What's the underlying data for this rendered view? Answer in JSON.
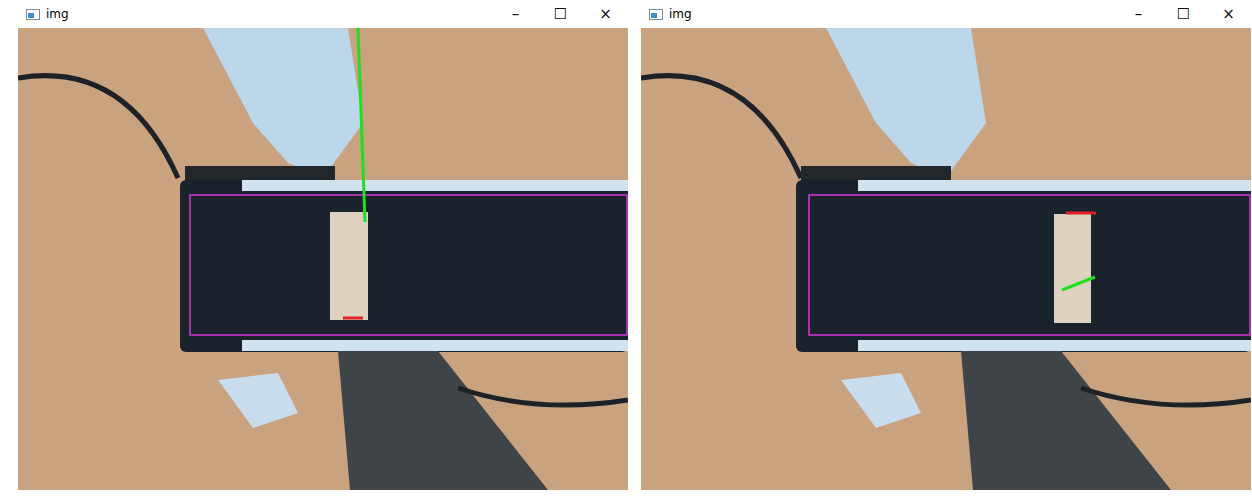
{
  "windows": [
    {
      "title": "img",
      "controls": {
        "minimize": "–",
        "maximize": "☐",
        "close": "×"
      }
    },
    {
      "title": "img",
      "controls": {
        "minimize": "–",
        "maximize": "☐",
        "close": "×"
      }
    }
  ]
}
